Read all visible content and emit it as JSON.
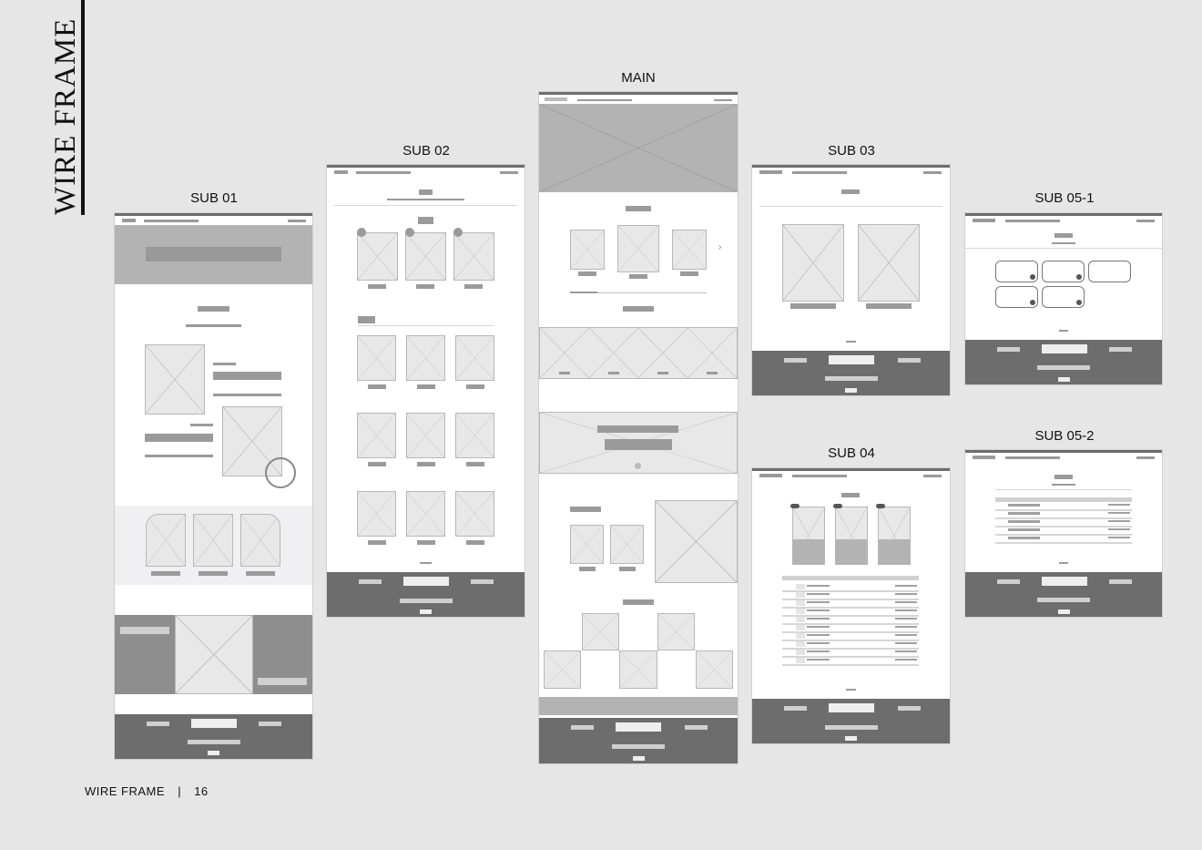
{
  "page": {
    "vertical_title": "WIRE FRAME",
    "footer_label": "WIRE FRAME",
    "footer_separator": "|",
    "page_number": "16"
  },
  "frames": [
    {
      "id": "sub01",
      "label": "SUB 01"
    },
    {
      "id": "sub02",
      "label": "SUB 02"
    },
    {
      "id": "main",
      "label": "MAIN"
    },
    {
      "id": "sub03",
      "label": "SUB 03"
    },
    {
      "id": "sub04",
      "label": "SUB 04"
    },
    {
      "id": "sub051",
      "label": "SUB 05-1"
    },
    {
      "id": "sub052",
      "label": "SUB 05-2"
    }
  ],
  "colors": {
    "background": "#e6e6e6",
    "frame": "#ffffff",
    "placeholder": "#e8e8e8",
    "block_grey": "#b3b3b3",
    "footer_dark": "#6d6d6d",
    "text": "#111111"
  },
  "icons": {
    "placeholder": "x-placeholder-icon",
    "arrow": "chevron-right-icon",
    "circle": "circle-icon"
  }
}
